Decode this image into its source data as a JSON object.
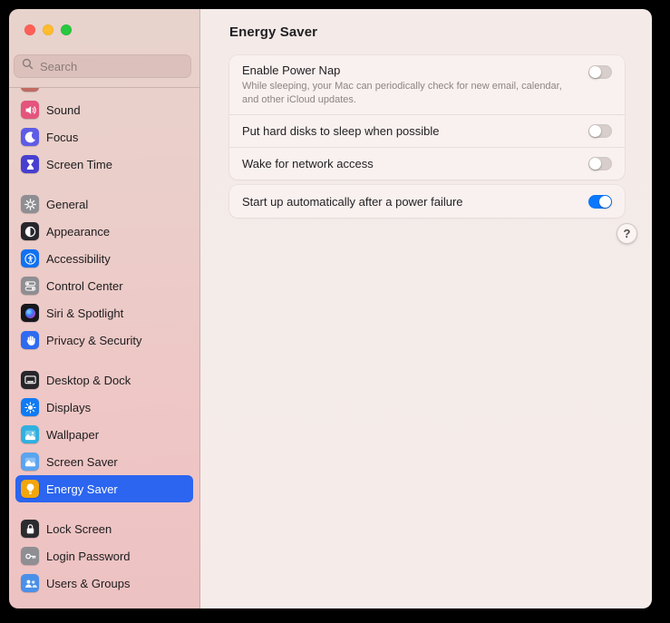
{
  "traffic_lights": {
    "close": "#ff5f57",
    "minimize": "#febc2e",
    "zoom": "#28c840"
  },
  "colors": {
    "accent_blue": "#0b79ff",
    "selection_blue": "#2b65f0",
    "toggle_off_track": "#d8cfcc"
  },
  "sidebar": {
    "search_placeholder": "Search",
    "selected_item": "Energy Saver",
    "groups": [
      {
        "items": [
          {
            "label": "",
            "icon": "clipped",
            "color": "#c06a63",
            "partial": true
          },
          {
            "label": "Sound",
            "icon": "speaker",
            "color": "#e4547c"
          },
          {
            "label": "Focus",
            "icon": "moon",
            "color": "#5e5ce6"
          },
          {
            "label": "Screen Time",
            "icon": "hourglass",
            "color": "#483fd0"
          }
        ]
      },
      {
        "items": [
          {
            "label": "General",
            "icon": "gear",
            "color": "#8e8e93"
          },
          {
            "label": "Appearance",
            "icon": "appearance",
            "color": "#26262c"
          },
          {
            "label": "Accessibility",
            "icon": "accessibility",
            "color": "#1271f0"
          },
          {
            "label": "Control Center",
            "icon": "control-center",
            "color": "#8e8e93"
          },
          {
            "label": "Siri & Spotlight",
            "icon": "siri",
            "color": "#17171c"
          },
          {
            "label": "Privacy & Security",
            "icon": "hand",
            "color": "#2e6bf0"
          }
        ]
      },
      {
        "items": [
          {
            "label": "Desktop & Dock",
            "icon": "desktop-dock",
            "color": "#26262b"
          },
          {
            "label": "Displays",
            "icon": "display-brightness",
            "color": "#0f7bf5"
          },
          {
            "label": "Wallpaper",
            "icon": "wallpaper",
            "color": "#31b0e0"
          },
          {
            "label": "Screen Saver",
            "icon": "screensaver",
            "color": "#5ba4ef"
          },
          {
            "label": "Energy Saver",
            "icon": "lightbulb",
            "color": "#f2a60d",
            "selected": true
          }
        ]
      },
      {
        "items": [
          {
            "label": "Lock Screen",
            "icon": "lock",
            "color": "#2b2b30"
          },
          {
            "label": "Login Password",
            "icon": "key",
            "color": "#8e8e93"
          },
          {
            "label": "Users & Groups",
            "icon": "users",
            "color": "#4a90e8"
          }
        ]
      }
    ]
  },
  "content": {
    "title": "Energy Saver",
    "help_label": "?",
    "groups": [
      {
        "rows": [
          {
            "label": "Enable Power Nap",
            "description": "While sleeping, your Mac can periodically check for new email, calendar, and other iCloud updates.",
            "type": "toggle",
            "value": false
          },
          {
            "label": "Put hard disks to sleep when possible",
            "type": "toggle",
            "value": false
          },
          {
            "label": "Wake for network access",
            "type": "toggle",
            "value": false
          }
        ]
      },
      {
        "rows": [
          {
            "label": "Start up automatically after a power failure",
            "type": "toggle",
            "value": true
          }
        ]
      }
    ]
  }
}
